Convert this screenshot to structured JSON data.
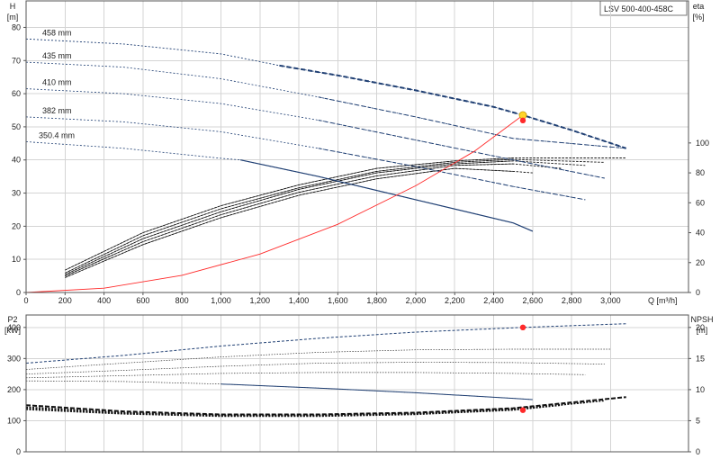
{
  "title": "LSV 500-400-458C",
  "chart_data": [
    {
      "type": "line",
      "panel": "head",
      "xlabel": "Q [m³/h]",
      "xlim": [
        0,
        3400
      ],
      "xticks": [
        0,
        200,
        400,
        600,
        800,
        1000,
        1200,
        1400,
        1600,
        1800,
        2000,
        2200,
        2400,
        2600,
        2800,
        3000
      ],
      "xtick_labels": [
        "0",
        "200",
        "400",
        "600",
        "800",
        "1,000",
        "1,200",
        "1,400",
        "1,600",
        "1,800",
        "2,000",
        "2,200",
        "2,400",
        "2,600",
        "2,800",
        "3,000"
      ],
      "ylabel_left": "H\n[m]",
      "ylim_left": [
        0,
        88
      ],
      "yticks_left": [
        0,
        10,
        20,
        30,
        40,
        50,
        60,
        70,
        80
      ],
      "ylabel_right": "eta\n[%]",
      "ylim_right": [
        0,
        195
      ],
      "yticks_right": [
        0,
        20,
        40,
        60,
        80,
        100
      ],
      "grid": true,
      "head_curves": [
        {
          "label": "458 mm",
          "x": [
            0,
            500,
            1000,
            1300,
            1600,
            2000,
            2400,
            2550,
            2800,
            3080
          ],
          "y": [
            76.5,
            75.0,
            72.0,
            68.5,
            65.5,
            61.0,
            56.0,
            53.5,
            49.0,
            43.5
          ],
          "solid_from": 1300,
          "solid_to": 3080
        },
        {
          "label": "435 mm",
          "x": [
            0,
            500,
            1000,
            1500,
            2000,
            2500,
            3080
          ],
          "y": [
            69.5,
            68.0,
            64.5,
            59.0,
            53.0,
            46.5,
            43.5
          ],
          "solid_from": 3080,
          "solid_to": 3080
        },
        {
          "label": "410 mm",
          "x": [
            0,
            500,
            1000,
            1500,
            2000,
            2500,
            2970
          ],
          "y": [
            61.5,
            60.0,
            57.0,
            52.0,
            46.0,
            40.0,
            34.5
          ],
          "solid_from": 2970,
          "solid_to": 2970
        },
        {
          "label": "382 mm",
          "x": [
            0,
            500,
            1000,
            1500,
            2000,
            2500,
            2870
          ],
          "y": [
            53.0,
            51.5,
            48.5,
            43.5,
            38.0,
            32.0,
            28.0
          ],
          "solid_from": 2870,
          "solid_to": 2870
        },
        {
          "label": "350.4 mm",
          "x": [
            0,
            500,
            1000,
            1100,
            1500,
            2000,
            2500,
            2600
          ],
          "y": [
            45.5,
            43.5,
            40.5,
            40.0,
            35.0,
            28.0,
            21.0,
            18.5
          ],
          "solid_from": 1100,
          "solid_to": 2600
        }
      ],
      "efficiency_curves": [
        {
          "x": [
            200,
            600,
            1000,
            1400,
            1800,
            2200,
            2500,
            3080
          ],
          "y": [
            15,
            40,
            58,
            72,
            83,
            88,
            90,
            90
          ]
        },
        {
          "x": [
            200,
            600,
            1000,
            1400,
            1800,
            2200,
            2500,
            2970
          ],
          "y": [
            13,
            38,
            56,
            70,
            81,
            87,
            89,
            87
          ]
        },
        {
          "x": [
            200,
            600,
            1000,
            1400,
            1800,
            2200,
            2500,
            2870
          ],
          "y": [
            12,
            36,
            54,
            69,
            80,
            86,
            88,
            85
          ]
        },
        {
          "x": [
            200,
            600,
            1000,
            1400,
            1800,
            2200,
            2500,
            2750
          ],
          "y": [
            11,
            34,
            52,
            67,
            78,
            85,
            86,
            83
          ]
        },
        {
          "x": [
            200,
            600,
            1000,
            1400,
            1800,
            2200,
            2500,
            2600
          ],
          "y": [
            10,
            32,
            50,
            65,
            76,
            83,
            81,
            80
          ]
        }
      ],
      "system_curve": {
        "x": [
          0,
          400,
          800,
          1200,
          1600,
          2000,
          2300,
          2550
        ],
        "y": [
          0,
          1.3,
          5.2,
          11.6,
          20.6,
          32.2,
          42.6,
          53.5
        ]
      },
      "duty_point": {
        "x": 2550,
        "y": 53.5
      },
      "eta_point": {
        "x": 2550,
        "y": 100
      }
    },
    {
      "type": "line",
      "panel": "power",
      "ylabel_left": "P2\n[kW]",
      "ylim_left": [
        0,
        440
      ],
      "yticks_left": [
        0,
        100,
        200,
        300,
        400
      ],
      "ylabel_right": "NPSH\n[m]",
      "ylim_right": [
        0,
        22
      ],
      "yticks_right": [
        0,
        5,
        10,
        15,
        20
      ],
      "grid": true,
      "power_curves": [
        {
          "x": [
            0,
            500,
            1000,
            1500,
            2000,
            2550,
            3080
          ],
          "y": [
            285,
            310,
            340,
            365,
            385,
            400,
            412
          ]
        },
        {
          "x": [
            0,
            500,
            1000,
            1500,
            2000,
            2500,
            3000
          ],
          "y": [
            265,
            285,
            305,
            320,
            328,
            330,
            330
          ]
        },
        {
          "x": [
            0,
            500,
            1000,
            1500,
            2000,
            2500,
            2970
          ],
          "y": [
            250,
            262,
            275,
            285,
            288,
            287,
            282
          ]
        },
        {
          "x": [
            0,
            500,
            1000,
            1500,
            2000,
            2500,
            2870
          ],
          "y": [
            238,
            245,
            252,
            255,
            255,
            252,
            248
          ]
        },
        {
          "x": [
            0,
            500,
            1000,
            1500,
            2000,
            2500,
            2600
          ],
          "y": [
            228,
            226,
            218,
            205,
            190,
            172,
            168
          ]
        }
      ],
      "npsh_curves": [
        {
          "x": [
            0,
            500,
            1000,
            1500,
            2000,
            2500,
            3080
          ],
          "y": [
            7.5,
            6.5,
            6.0,
            6.0,
            6.3,
            7.0,
            8.8
          ]
        },
        {
          "x": [
            0,
            500,
            1000,
            1500,
            2000,
            2500,
            2970
          ],
          "y": [
            7.2,
            6.3,
            5.9,
            5.9,
            6.2,
            6.9,
            8.2
          ]
        },
        {
          "x": [
            0,
            500,
            1000,
            1500,
            2000,
            2500,
            2870
          ],
          "y": [
            7.0,
            6.2,
            5.8,
            5.8,
            6.1,
            6.8,
            7.9
          ]
        },
        {
          "x": [
            0,
            500,
            1000,
            1500,
            2000,
            2500,
            2750
          ],
          "y": [
            6.8,
            6.1,
            5.7,
            5.7,
            6.0,
            6.7,
            7.5
          ]
        }
      ],
      "power_point": {
        "x": 2550,
        "y": 400
      },
      "npsh_point": {
        "x": 2550,
        "y": 6.7
      }
    }
  ],
  "colors": {
    "head": "#1f3f73",
    "efficiency": "#111111",
    "system": "#ff2a2a",
    "duty_point": "#ffd42a",
    "eta_point": "#ff2a2a"
  }
}
